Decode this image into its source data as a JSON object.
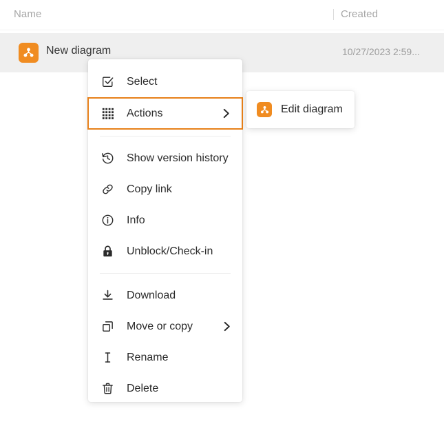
{
  "list_header": {
    "name_label": "Name",
    "created_label": "Created"
  },
  "file_row": {
    "icon": "diagram-icon",
    "name": "New diagram",
    "created": "10/27/2023 2:59..."
  },
  "context_menu": {
    "items": [
      {
        "id": "select",
        "icon": "checkbox-checked-icon",
        "label": "Select",
        "has_submenu": false,
        "focused": false
      },
      {
        "id": "actions",
        "icon": "grid-dots-icon",
        "label": "Actions",
        "has_submenu": true,
        "focused": true
      },
      {
        "id": "version",
        "icon": "history-icon",
        "label": "Show version history",
        "has_submenu": false,
        "focused": false
      },
      {
        "id": "copylink",
        "icon": "link-icon",
        "label": "Copy link",
        "has_submenu": false,
        "focused": false
      },
      {
        "id": "info",
        "icon": "info-circle-icon",
        "label": "Info",
        "has_submenu": false,
        "focused": false
      },
      {
        "id": "unblock",
        "icon": "lock-icon",
        "label": "Unblock/Check-in",
        "has_submenu": false,
        "focused": false
      },
      {
        "id": "download",
        "icon": "download-icon",
        "label": "Download",
        "has_submenu": false,
        "focused": false
      },
      {
        "id": "move",
        "icon": "copy-icon",
        "label": "Move or copy",
        "has_submenu": true,
        "focused": false
      },
      {
        "id": "rename",
        "icon": "text-cursor-icon",
        "label": "Rename",
        "has_submenu": false,
        "focused": false
      },
      {
        "id": "delete",
        "icon": "trash-icon",
        "label": "Delete",
        "has_submenu": false,
        "focused": false
      }
    ]
  },
  "submenu": {
    "items": [
      {
        "id": "edit-diagram",
        "icon": "diagram-icon",
        "label": "Edit diagram"
      }
    ]
  },
  "colors": {
    "accent_orange": "#f08c21",
    "focus_orange": "#e78019",
    "row_background": "#efefef",
    "text_primary": "#2b2b2b",
    "text_muted": "#a6a6a6"
  }
}
